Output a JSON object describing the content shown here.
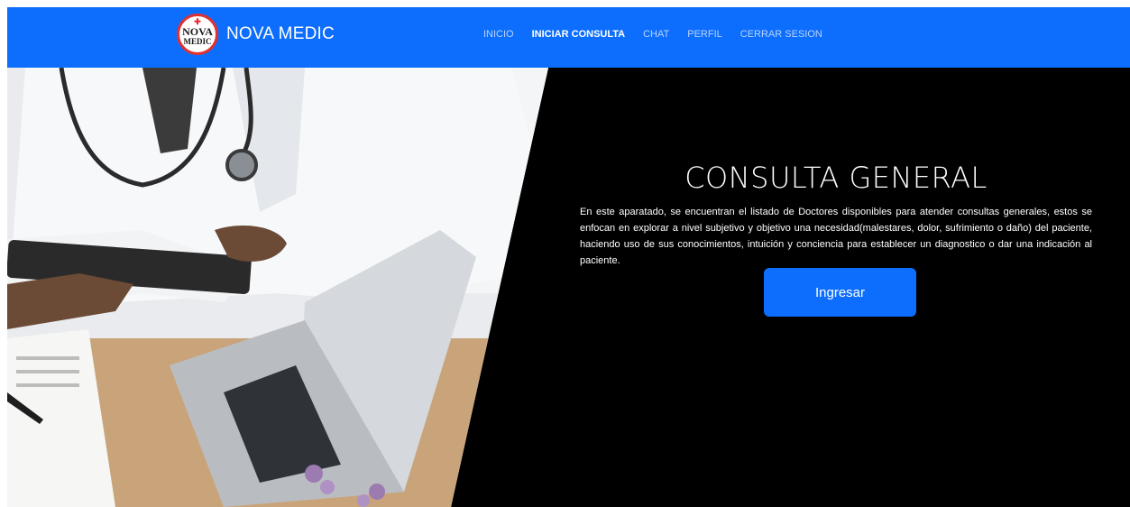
{
  "brand": {
    "logo_line1": "NOVA",
    "logo_line2": "MEDIC",
    "name": "NOVA MEDIC"
  },
  "nav": {
    "items": [
      {
        "label": "INICIO",
        "active": false
      },
      {
        "label": "INICIAR CONSULTA",
        "active": true
      },
      {
        "label": "CHAT",
        "active": false
      },
      {
        "label": "PERFIL",
        "active": false
      },
      {
        "label": "CERRAR SESION",
        "active": false
      }
    ]
  },
  "hero": {
    "title": "CONSULTA GENERAL",
    "description": "En este aparatado, se encuentran el listado de Doctores disponibles para atender consultas generales, estos se enfocan en explorar a nivel subjetivo y objetivo una necesidad(malestares, dolor, sufrimiento o daño) del paciente, haciendo uso de sus conocimientos, intuición y conciencia para establecer un diagnostico o dar una indicación al paciente.",
    "button_label": "Ingresar"
  },
  "colors": {
    "primary": "#0d6efd",
    "hero_bg": "#000000",
    "logo_accent": "#e03131"
  },
  "icons": {
    "photo": "doctor-with-tablet-and-laptop-photo"
  }
}
